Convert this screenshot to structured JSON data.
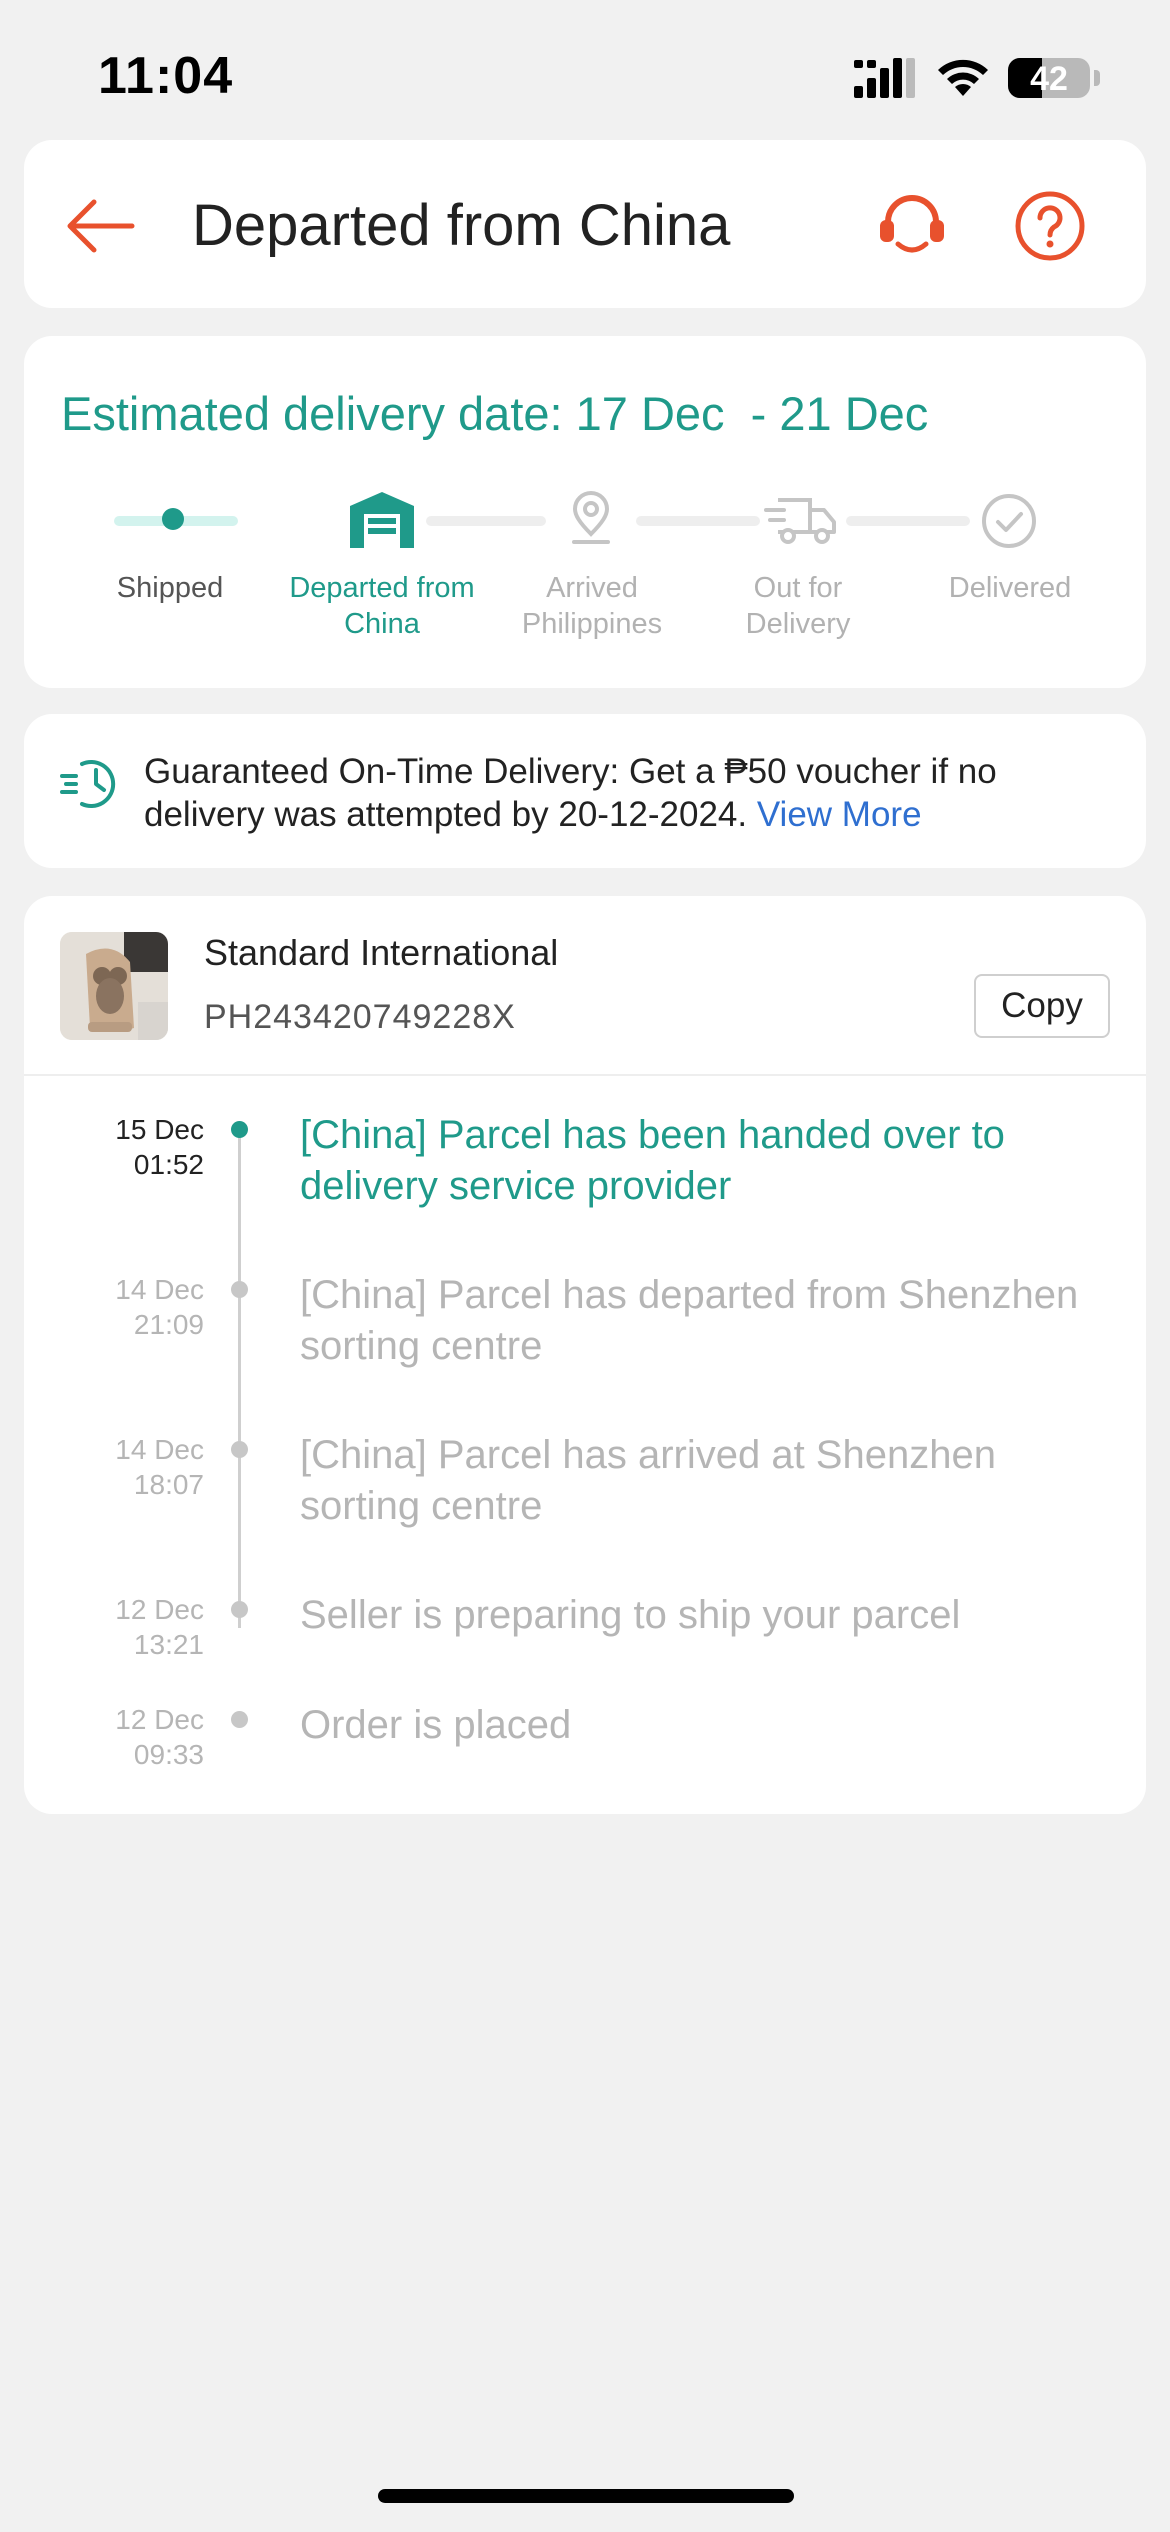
{
  "status_bar": {
    "time": "11:04",
    "battery": "42",
    "battery_level": 0.42,
    "icons": [
      "signal-icon",
      "wifi-icon",
      "battery-icon"
    ]
  },
  "header": {
    "title": "Departed from China",
    "icons": [
      "back-arrow-icon",
      "headset-icon",
      "question-icon"
    ]
  },
  "delivery": {
    "estimate": "Estimated delivery date: 17 Dec  - 21 Dec",
    "steps": [
      {
        "label": "Shipped",
        "state": "done",
        "icon": "dot-icon"
      },
      {
        "label": "Departed from China",
        "state": "current",
        "icon": "warehouse-icon"
      },
      {
        "label": "Arrived Philippines",
        "state": "pending",
        "icon": "location-pin-icon"
      },
      {
        "label": "Out for Delivery",
        "state": "pending",
        "icon": "truck-icon"
      },
      {
        "label": "Delivered",
        "state": "pending",
        "icon": "check-circle-icon"
      }
    ]
  },
  "guarantee": {
    "text": "Guaranteed On-Time Delivery: Get a ₱50 voucher if no delivery was attempted by 20-12-2024. ",
    "link": "View More",
    "icon": "fast-clock-icon"
  },
  "tracking": {
    "carrier": "Standard International",
    "number": "PH243420749228X",
    "copy_label": "Copy",
    "events": [
      {
        "date": "15 Dec",
        "time": "01:52",
        "text": "[China] Parcel has been handed over to delivery service provider",
        "active": true
      },
      {
        "date": "14 Dec",
        "time": "21:09",
        "text": "[China] Parcel has departed from Shenzhen sorting centre",
        "active": false
      },
      {
        "date": "14 Dec",
        "time": "18:07",
        "text": "[China] Parcel has arrived at Shenzhen sorting centre",
        "active": false
      },
      {
        "date": "12 Dec",
        "time": "13:21",
        "text": "Seller is preparing to ship your parcel",
        "active": false
      },
      {
        "date": "12 Dec",
        "time": "09:33",
        "text": "Order is placed",
        "active": false
      }
    ]
  },
  "colors": {
    "accent": "#1f9a8a",
    "brand_orange": "#e8512d",
    "link": "#2f6fd0",
    "background": "#f1f1f1"
  }
}
